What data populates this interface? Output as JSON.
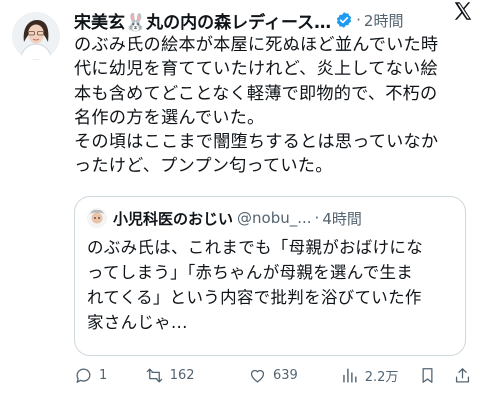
{
  "post": {
    "author": "宋美玄🐰丸の内の森レディース…",
    "separator": "·",
    "time": "2時間",
    "lines": [
      "のぶみ氏の絵本が本屋に死ぬほど並んでいた時",
      "代に幼児を育てていたけれど、炎上してない絵",
      "本も含めてどことなく軽薄で即物的で、不朽の",
      "名作の方を選んでいた。",
      "その頃はここまで闇堕ちするとは思っていなか",
      "ったけど、プンプン匂っていた。"
    ]
  },
  "quote": {
    "author": "小児科医のおじい",
    "handle": "@nobu_...",
    "separator": "·",
    "time": "4時間",
    "lines": [
      "のぶみ氏は、これまでも「母親がおばけにな",
      "ってしまう」「赤ちゃんが母親を選んで生ま",
      "れてくる」という内容で批判を浴びていた作",
      "家さんじゃ..."
    ]
  },
  "actions": {
    "replies": "1",
    "reposts": "162",
    "likes": "639",
    "views": "2.2万"
  },
  "colors": {
    "text": "#0f1419",
    "muted": "#536471",
    "verified": "#1d9bf0",
    "border": "#cfd9de"
  },
  "icons": [
    "x-logo-icon",
    "verified-badge-icon",
    "reply-icon",
    "repost-icon",
    "like-icon",
    "views-icon",
    "bookmark-icon",
    "share-icon"
  ]
}
